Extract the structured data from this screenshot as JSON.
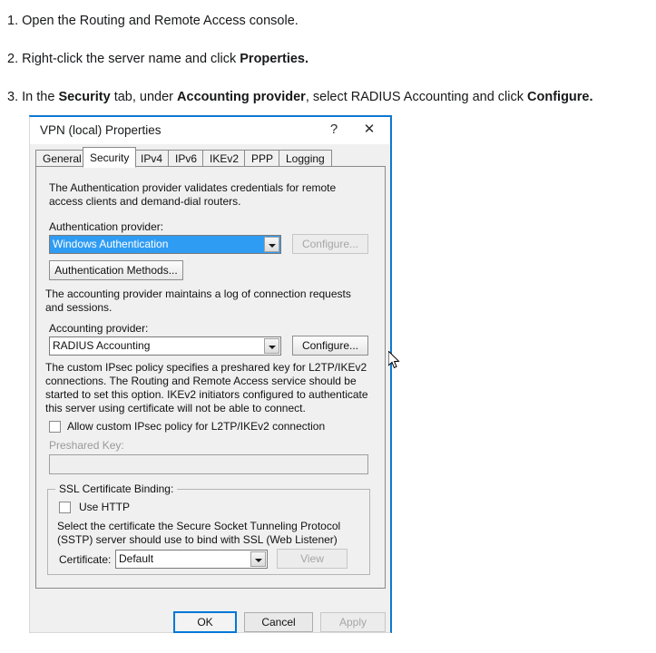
{
  "instructions": [
    {
      "id": "step-1",
      "parts": [
        {
          "t": "1. Open the Routing and Remote Access console.",
          "b": false
        }
      ]
    },
    {
      "id": "step-2",
      "parts": [
        {
          "t": "2. Right-click the server name and click ",
          "b": false
        },
        {
          "t": "Properties.",
          "b": true
        }
      ]
    },
    {
      "id": "step-3",
      "parts": [
        {
          "t": "3. In the ",
          "b": false
        },
        {
          "t": "Security",
          "b": true
        },
        {
          "t": " tab, under ",
          "b": false
        },
        {
          "t": "Accounting provider",
          "b": true
        },
        {
          "t": ", select RADIUS Accounting and click ",
          "b": false
        },
        {
          "t": "Configure.",
          "b": true
        }
      ]
    }
  ],
  "instructions_plain": {
    "step1": "1. Open the Routing and Remote Access console.",
    "step2": "2. Right-click the server name and click Properties.",
    "step3": "3. In the Security tab, under Accounting provider, select RADIUS Accounting and click Configure."
  },
  "dialog": {
    "title": "VPN (local) Properties",
    "help_label": "?",
    "close_label": "✕",
    "tabs": [
      {
        "label": "General",
        "selected": false
      },
      {
        "label": "Security",
        "selected": true
      },
      {
        "label": "IPv4",
        "selected": false
      },
      {
        "label": "IPv6",
        "selected": false
      },
      {
        "label": "IKEv2",
        "selected": false
      },
      {
        "label": "PPP",
        "selected": false
      },
      {
        "label": "Logging",
        "selected": false
      }
    ],
    "security": {
      "auth_description": "The Authentication provider validates credentials for remote access clients and demand-dial routers.",
      "auth_provider_label": "Authentication provider:",
      "auth_provider_value": "Windows Authentication",
      "auth_configure_label": "Configure...",
      "auth_methods_label": "Authentication Methods...",
      "accounting_description": "The accounting provider maintains a log of connection requests and sessions.",
      "accounting_provider_label": "Accounting provider:",
      "accounting_provider_value": "RADIUS Accounting",
      "accounting_configure_label": "Configure...",
      "ipsec_description": "The custom IPsec policy specifies a preshared key for L2TP/IKEv2 connections. The Routing and Remote Access service should be started to set this option. IKEv2 initiators configured to authenticate this server using certificate will not be able to connect.",
      "ipsec_checkbox_label": "Allow custom IPsec policy for L2TP/IKEv2 connection",
      "ipsec_checked": false,
      "preshared_key_label": "Preshared Key:",
      "preshared_key_value": "",
      "ssl_group_label": "SSL Certificate Binding:",
      "use_http_label": "Use HTTP",
      "use_http_checked": false,
      "ssl_description": "Select the certificate the Secure Socket Tunneling Protocol (SSTP) server should use to bind with SSL (Web Listener)",
      "certificate_label": "Certificate:",
      "certificate_value": "Default",
      "view_label": "View"
    },
    "footer": {
      "ok_label": "OK",
      "cancel_label": "Cancel",
      "apply_label": "Apply"
    }
  },
  "colors": {
    "accent_blue": "#0078d7",
    "window_border_blue": "#1878c8",
    "selection_blue": "#2f9cf4",
    "dialog_face": "#f0f0f0",
    "disabled_text": "#a6a6a6"
  }
}
